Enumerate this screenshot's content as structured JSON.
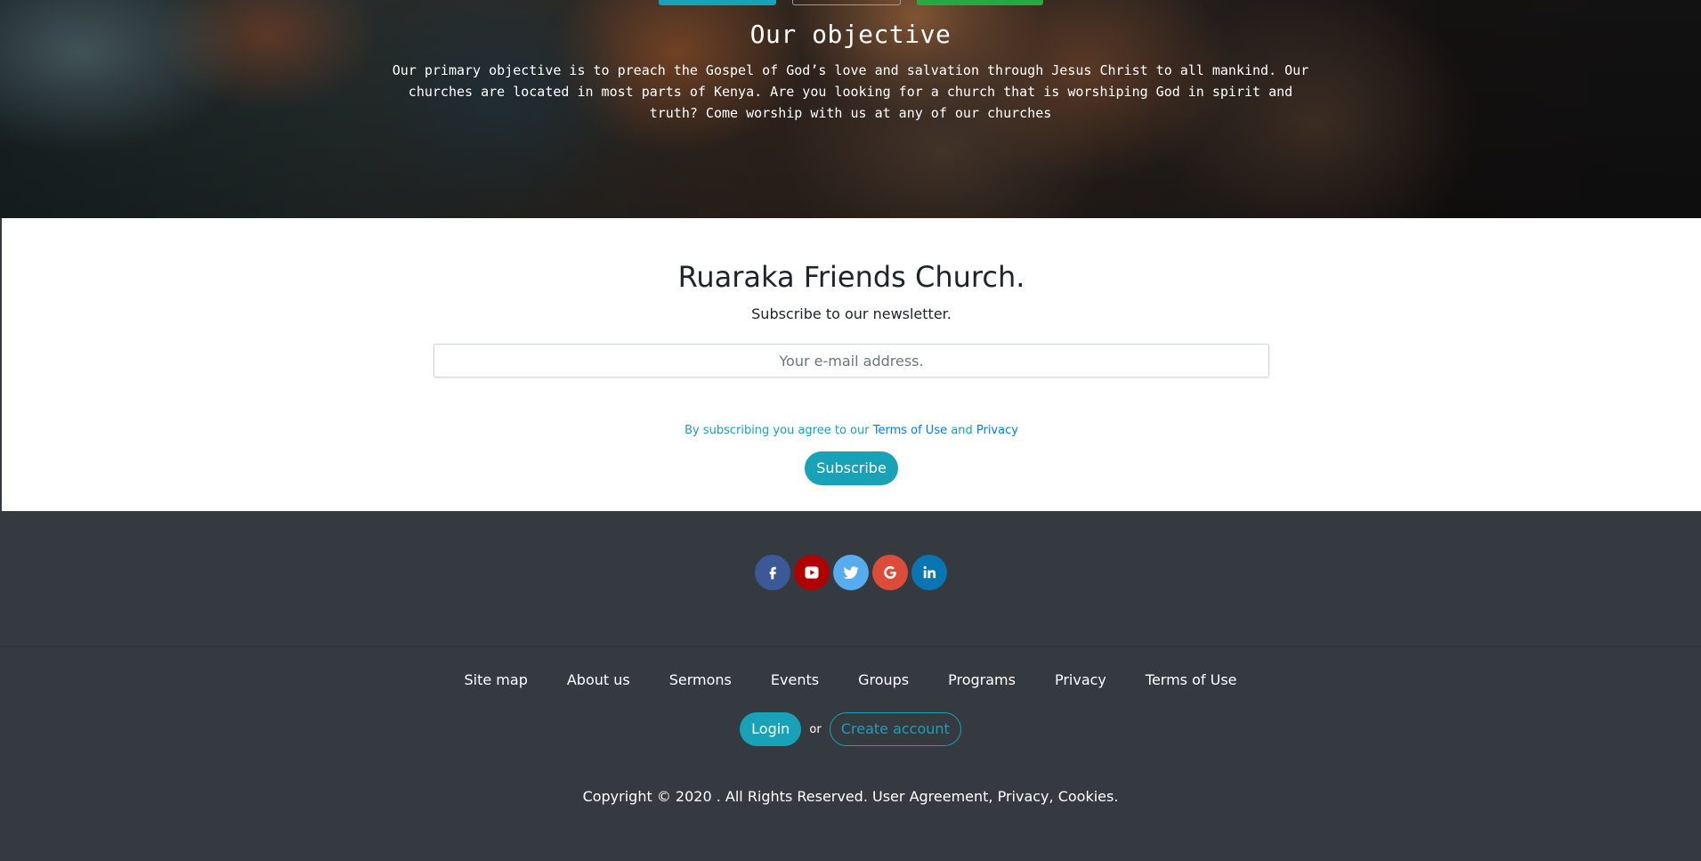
{
  "hero": {
    "title": "Our objective",
    "text": "Our primary objective is to preach the Gospel of God’s love and salvation through Jesus Christ to all mankind. Our churches are located in most parts of Kenya. Are you looking for a church that is worshiping God in spirit and truth? Come worship with us at any of our churches"
  },
  "newsletter": {
    "title": "Ruaraka Friends Church.",
    "subtitle": "Subscribe to our newsletter.",
    "email_placeholder": "Your e-mail address.",
    "terms_prefix": "By subscribing you agree to our",
    "terms_link": "Terms of Use",
    "terms_and": "and",
    "privacy_link": "Privacy",
    "subscribe_label": "Subscribe"
  },
  "footer": {
    "socials": [
      {
        "name": "facebook-icon",
        "color": "#3b5998"
      },
      {
        "name": "youtube-icon",
        "color": "#b00000"
      },
      {
        "name": "twitter-icon",
        "color": "#55acee"
      },
      {
        "name": "google-icon",
        "color": "#dd4b39"
      },
      {
        "name": "linkedin-icon",
        "color": "#0976b4"
      }
    ],
    "links": [
      "Site map",
      "About us",
      "Sermons",
      "Events",
      "Groups",
      "Programs",
      "Privacy",
      "Terms of Use"
    ],
    "login_label": "Login",
    "or_label": "or",
    "create_label": "Create account",
    "copyright": "Copyright © 2020 . All Rights Reserved. User Agreement, Privacy, Cookies."
  },
  "colors": {
    "accent": "#17a2b8",
    "footer_bg": "#343a40",
    "link": "#007bff"
  }
}
